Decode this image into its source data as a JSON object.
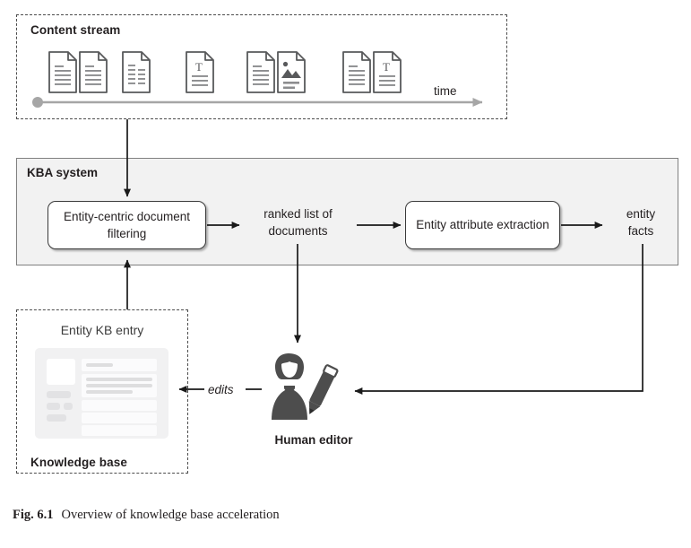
{
  "figure": {
    "caption_number": "Fig. 6.1",
    "caption_text": "Overview of knowledge base acceleration"
  },
  "content_stream": {
    "title": "Content stream",
    "time_axis_label": "time",
    "documents": [
      {
        "kind": "text-document-icon",
        "variant": "lines"
      },
      {
        "kind": "text-document-icon",
        "variant": "lines"
      },
      {
        "kind": "list-document-icon",
        "variant": "two-column"
      },
      {
        "kind": "titled-document-icon",
        "variant": "T-heading"
      },
      {
        "kind": "text-document-icon",
        "variant": "lines"
      },
      {
        "kind": "image-document-icon",
        "variant": "picture"
      },
      {
        "kind": "text-document-icon",
        "variant": "lines"
      },
      {
        "kind": "titled-document-icon",
        "variant": "T-heading"
      }
    ]
  },
  "kba_system": {
    "title": "KBA system",
    "filtering_box": "Entity-centric\ndocument filtering",
    "ranked_list_label": "ranked list of\ndocuments",
    "extraction_box": "Entity attribute\nextraction",
    "entity_facts_label": "entity\nfacts"
  },
  "knowledge_base": {
    "title": "Knowledge base",
    "entry_label": "Entity KB entry"
  },
  "editor": {
    "label": "Human editor",
    "edits_label": "edits"
  },
  "colors": {
    "panel_fill": "#f2f2f2",
    "panel_border": "#808080",
    "dashed_border": "#4d4d4d",
    "arrow": "#1a1a1a",
    "timeline": "#a6a6a6",
    "doc_outline": "#58595b",
    "doc_detail": "#8c8d8f",
    "person": "#4d4d4d",
    "text": "#231f20"
  }
}
